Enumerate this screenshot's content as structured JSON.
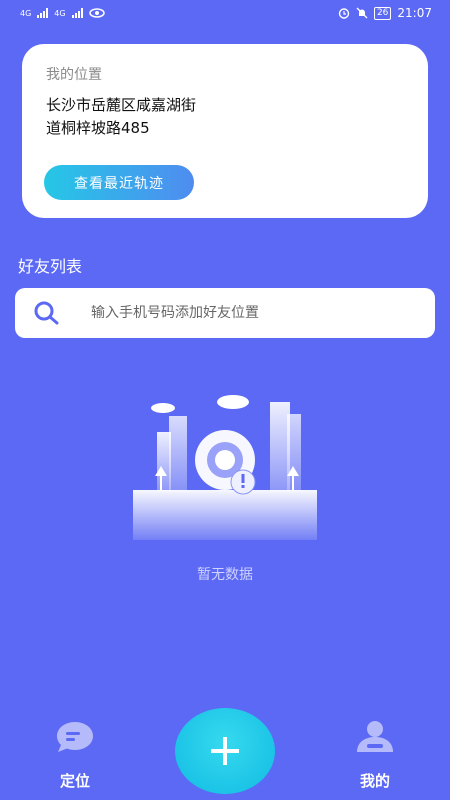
{
  "status_bar": {
    "network_1": "4G",
    "network_2": "4G",
    "battery": "26",
    "time": "21:07"
  },
  "location_card": {
    "label": "我的位置",
    "address_line1": "长沙市岳麓区咸嘉湖街",
    "address_line2": "道桐梓坡路485",
    "track_button": "查看最近轨迹"
  },
  "friends": {
    "title": "好友列表",
    "search_placeholder": "输入手机号码添加好友位置",
    "empty_text": "暂无数据"
  },
  "nav": {
    "locate_label": "定位",
    "mine_label": "我的",
    "add_icon": "plus-icon"
  },
  "colors": {
    "background": "#5b69f4",
    "accent_cyan": "#1cc4e6",
    "button_gradient_start": "#25c7e6",
    "button_gradient_end": "#4f8cf0"
  }
}
